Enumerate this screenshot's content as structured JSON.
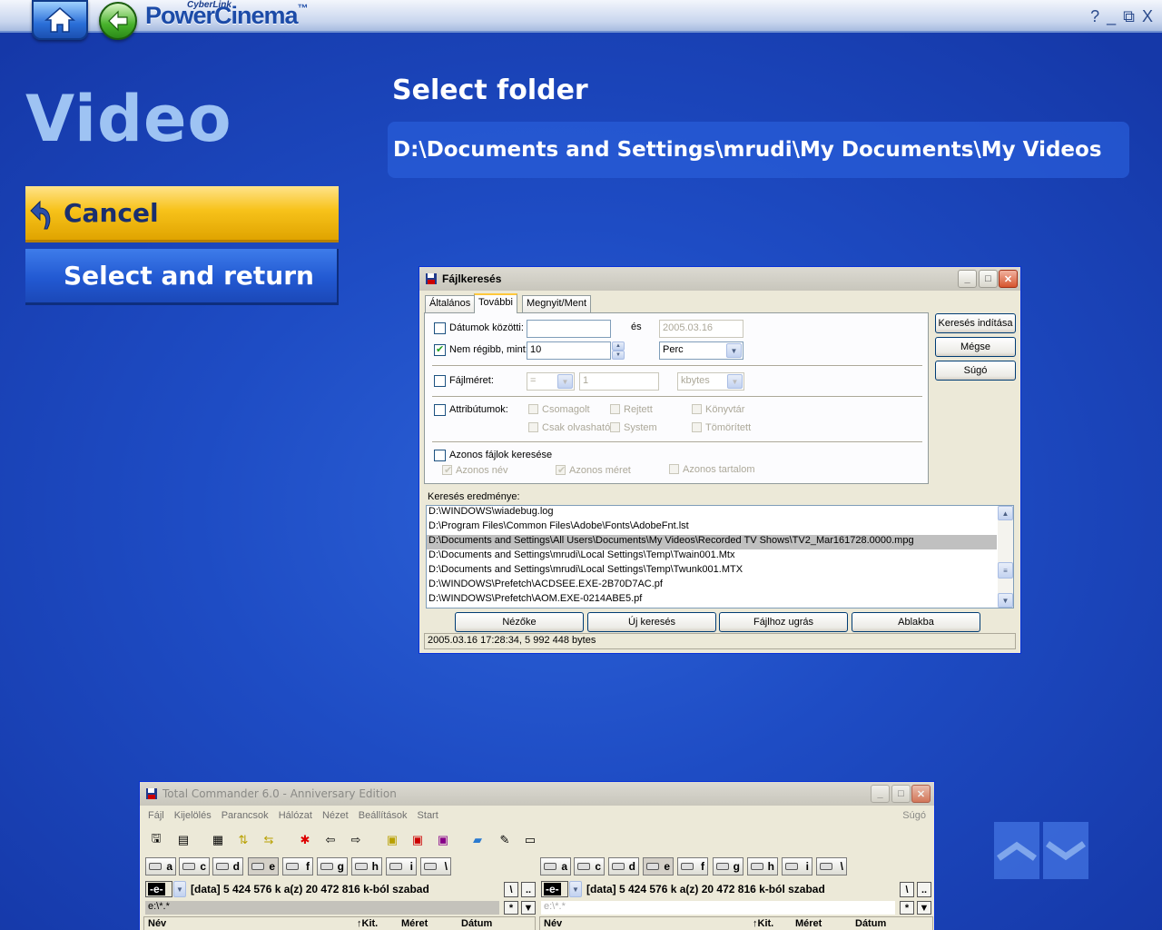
{
  "app": {
    "brand_small": "CyberLink",
    "brand": "PowerCinema",
    "brand_tm": "™",
    "window_controls": [
      "?",
      "_",
      "⧉",
      "X"
    ]
  },
  "page": {
    "title": "Video",
    "section_title": "Select folder",
    "path": "D:\\Documents and Settings\\mrudi\\My Documents\\My Videos"
  },
  "menu": {
    "cancel": "Cancel",
    "select_return": "Select and return"
  },
  "search_dialog": {
    "title": "Fájlkeresés",
    "tabs": [
      "Általános",
      "További",
      "Megnyit/Ment"
    ],
    "active_tab": "További",
    "date_between_label": "Dátumok közötti:",
    "date_between_checked": false,
    "and_label": "és",
    "date_to_value": "2005.03.16",
    "not_older_label": "Nem régibb, mint:",
    "not_older_checked": true,
    "not_older_value": "10",
    "not_older_unit": "Perc",
    "filesize_label": "Fájlméret:",
    "filesize_op": "=",
    "filesize_value": "1",
    "filesize_unit": "kbytes",
    "attributes_label": "Attribútumok:",
    "attr": {
      "csomagolt": "Csomagolt",
      "rejtett": "Rejtett",
      "konyvtar": "Könyvtár",
      "csak_olvashato": "Csak olvasható",
      "system": "System",
      "tomoritett": "Tömörített"
    },
    "duplicates_label": "Azonos fájlok keresése",
    "dup_name": "Azonos név",
    "dup_size": "Azonos méret",
    "dup_content": "Azonos tartalom",
    "buttons": {
      "start": "Keresés indítása",
      "cancel": "Mégse",
      "help": "Súgó"
    },
    "results_label": "Keresés eredménye:",
    "results": [
      "D:\\WINDOWS\\wiadebug.log",
      "D:\\Program Files\\Common Files\\Adobe\\Fonts\\AdobeFnt.lst",
      "D:\\Documents and Settings\\All Users\\Documents\\My Videos\\Recorded TV Shows\\TV2_Mar161728.0000.mpg",
      "D:\\Documents and Settings\\mrudi\\Local Settings\\Temp\\Twain001.Mtx",
      "D:\\Documents and Settings\\mrudi\\Local Settings\\Temp\\Twunk001.MTX",
      "D:\\WINDOWS\\Prefetch\\ACDSEE.EXE-2B70D7AC.pf",
      "D:\\WINDOWS\\Prefetch\\AOM.EXE-0214ABE5.pf"
    ],
    "selected_result_index": 2,
    "bottom_buttons": {
      "viewer": "Nézőke",
      "new_search": "Új keresés",
      "goto_file": "Fájlhoz ugrás",
      "panel": "Ablakba"
    },
    "status": "2005.03.16 17:28:34, 5 992 448 bytes"
  },
  "tc": {
    "title": "Total Commander 6.0 - Anniversary Edition",
    "menu": [
      "Fájl",
      "Kijelölés",
      "Parancsok",
      "Hálózat",
      "Nézet",
      "Beállítások",
      "Start"
    ],
    "help": "Súgó",
    "drives": [
      "a",
      "c",
      "d",
      "e",
      "f",
      "g",
      "h",
      "i",
      "\\"
    ],
    "left": {
      "drive": "-e-",
      "info": "[data]  5 424 576 k a(z) 20 472 816 k-ból szabad",
      "path": "e:\\*.*"
    },
    "right": {
      "drive": "-e-",
      "info": "[data]  5 424 576 k a(z) 20 472 816 k-ból szabad",
      "path": "e:\\*.*"
    },
    "root_btn": "\\",
    "up_btn": "..",
    "star_btn": "*",
    "columns": {
      "name": "Név",
      "ext": "↑Kit.",
      "size": "Méret",
      "date": "Dátum"
    }
  },
  "colors": {
    "accent_yellow": "#f7c21a",
    "background_blue": "#1e4cc4"
  }
}
